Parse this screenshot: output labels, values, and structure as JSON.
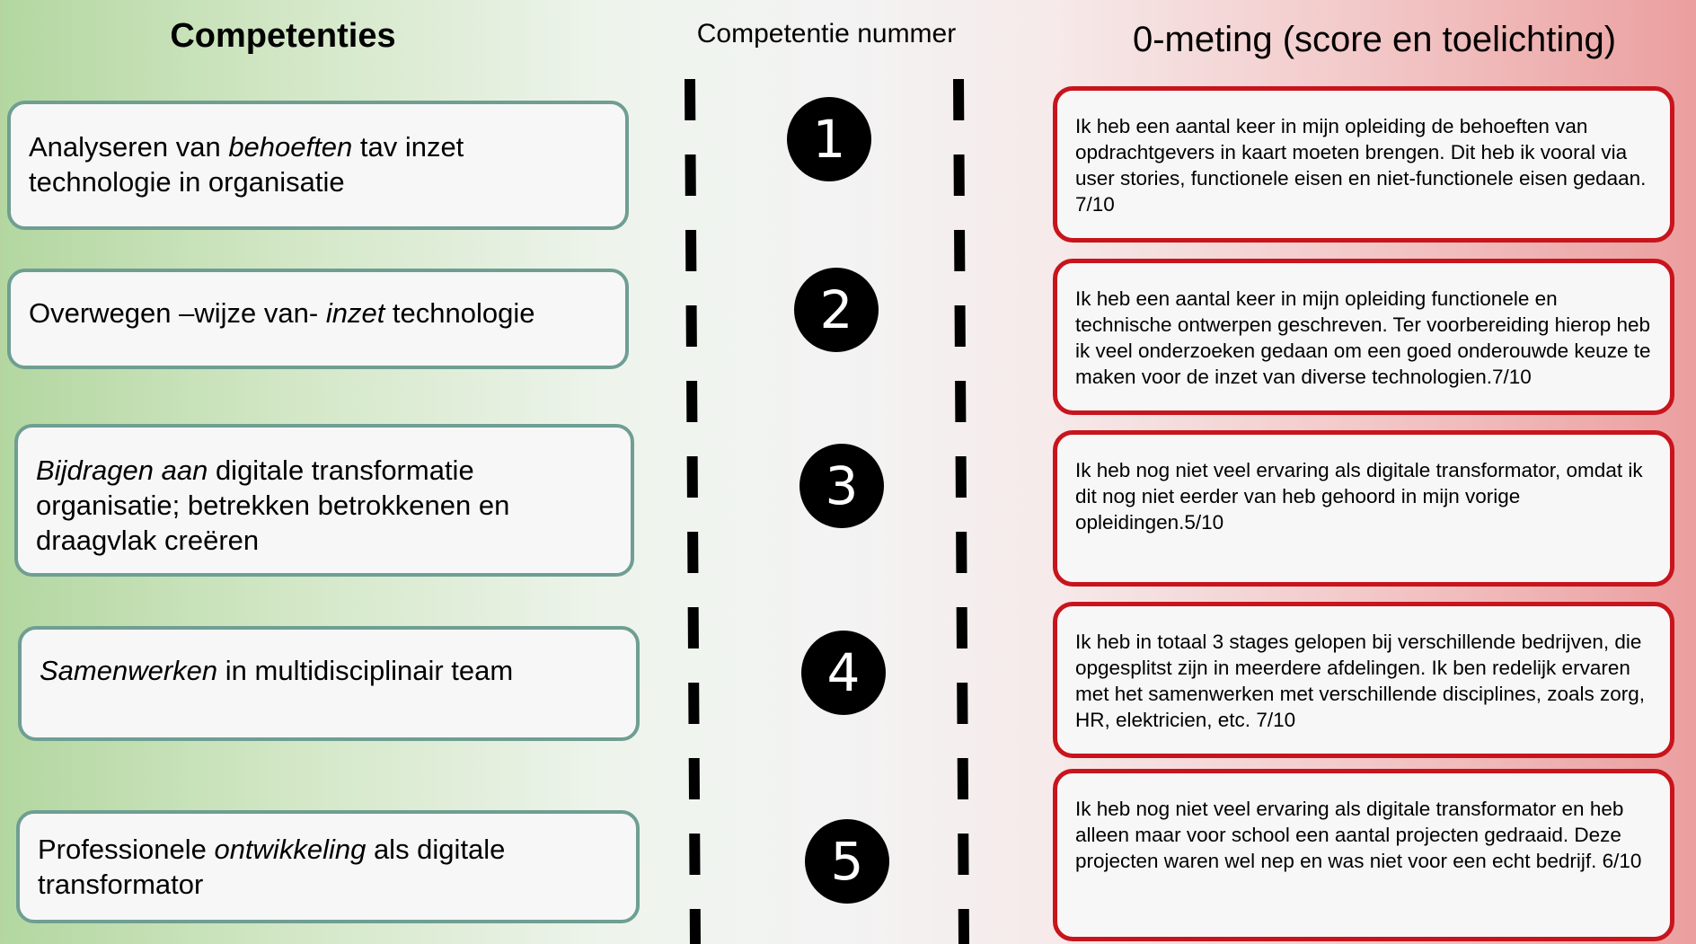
{
  "headers": {
    "competencies": "Competenties",
    "number": "Competentie nummer",
    "measurement": "0-meting (score en toelichting)"
  },
  "competencies": [
    {
      "parts": [
        {
          "t": "Analyseren van ",
          "i": false
        },
        {
          "t": "behoeften",
          "i": true
        },
        {
          "t": " tav inzet technologie in organisatie",
          "i": false
        }
      ]
    },
    {
      "parts": [
        {
          "t": "Overwegen  –wijze van- ",
          "i": false
        },
        {
          "t": "inzet",
          "i": true
        },
        {
          "t": " technologie",
          "i": false
        }
      ]
    },
    {
      "parts": [
        {
          "t": "Bijdragen aan",
          "i": true
        },
        {
          "t": " digitale transformatie organisatie; betrekken betrokkenen en draagvlak creëren",
          "i": false
        }
      ]
    },
    {
      "parts": [
        {
          "t": "Samenwerken",
          "i": true
        },
        {
          "t": " in multidisciplinair team",
          "i": false
        }
      ]
    },
    {
      "parts": [
        {
          "t": "Professionele ",
          "i": false
        },
        {
          "t": "ontwikkeling",
          "i": true
        },
        {
          "t": " als digitale transformator",
          "i": false
        }
      ]
    }
  ],
  "numbers": [
    "1",
    "2",
    "3",
    "4",
    "5"
  ],
  "measurements": [
    "Ik heb een aantal keer in mijn opleiding de behoeften van opdrachtgevers in kaart moeten brengen. Dit heb ik vooral via user stories, functionele eisen en niet-functionele eisen gedaan. 7/10",
    "Ik heb een aantal keer in mijn opleiding functionele en technische ontwerpen geschreven. Ter voorbereiding hierop heb ik veel onderzoeken gedaan om een goed onderouwde keuze te maken voor de inzet van diverse technologien.7/10",
    "Ik heb nog niet veel ervaring als digitale transformator, omdat ik dit nog niet eerder van heb gehoord in mijn vorige opleidingen.5/10",
    "Ik heb in totaal 3 stages gelopen bij verschillende bedrijven, die opgesplitst zijn in meerdere afdelingen. Ik ben redelijk ervaren met het samenwerken met verschillende disciplines, zoals zorg, HR, elektricien, etc. 7/10",
    "Ik heb nog niet veel ervaring als digitale transformator en heb alleen maar voor school een aantal projecten gedraaid. Deze projecten waren wel nep en was niet voor een echt bedrijf. 6/10"
  ],
  "colors": {
    "competency_border": "#6f9e93",
    "measurement_border": "#c8141c",
    "number_fill": "#000000"
  }
}
